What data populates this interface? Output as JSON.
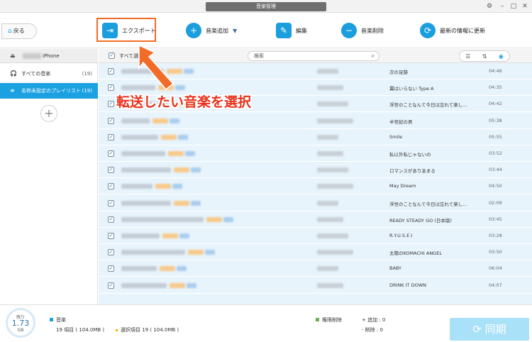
{
  "window": {
    "title": "音楽管理"
  },
  "toolbar": {
    "back_label": "戻る",
    "export_label": "エクスポート",
    "add_label": "音楽追加",
    "edit_label": "編集",
    "delete_label": "音楽削除",
    "refresh_label": "最新の情報に更新"
  },
  "sidebar": {
    "device_name": "iPhone",
    "items": [
      {
        "label": "すべての音楽",
        "count": "(19)"
      },
      {
        "label": "名称未設定のプレイリスト",
        "count": "(19)"
      }
    ]
  },
  "listbar": {
    "select_all_label": "すべて選択",
    "search_placeholder": "検索"
  },
  "rows": [
    {
      "title": "次の足跡",
      "duration": "04:46"
    },
    {
      "title": "翼はいらない Type A",
      "duration": "04:35"
    },
    {
      "title": "浮世のことなんて今日は忘れて楽し...",
      "duration": "04:42"
    },
    {
      "title": "半世紀の男",
      "duration": "05:38"
    },
    {
      "title": "Smile",
      "duration": "05:55"
    },
    {
      "title": "私以外私じゃないの",
      "duration": "03:52"
    },
    {
      "title": "ロマンスがありあまる",
      "duration": "03:44"
    },
    {
      "title": "May Dream",
      "duration": "04:50"
    },
    {
      "title": "浮世のことなんて今日は忘れて楽し...",
      "duration": "02:09"
    },
    {
      "title": "READY STEADY GO (日本版)",
      "duration": "03:45"
    },
    {
      "title": "R.Y.U.S.E.I",
      "duration": "03:28"
    },
    {
      "title": "太陽のKOMACHI ANGEL",
      "duration": "03:50"
    },
    {
      "title": "BABY",
      "duration": "06:04"
    },
    {
      "title": "DRINK IT DOWN",
      "duration": "04:07"
    }
  ],
  "annotation": {
    "callout": "転送したい音楽を選択"
  },
  "footer": {
    "storage_label": "残り",
    "storage_value": "1.73",
    "storage_unit": "GB",
    "media_label": "音楽",
    "total_items": "19 項目 ( 104.0MB )",
    "selected_items": "選択項目 19 ( 104.0MB )",
    "restricted_label": "権限削除",
    "added": "+ 追加 : 0",
    "removed": "- 削除 : 0",
    "sync_label": "同期"
  },
  "colors": {
    "accent": "#1ba1e2",
    "highlight": "#f26b27",
    "callout": "#e8321c",
    "row_bg": "#e8f4fc"
  }
}
